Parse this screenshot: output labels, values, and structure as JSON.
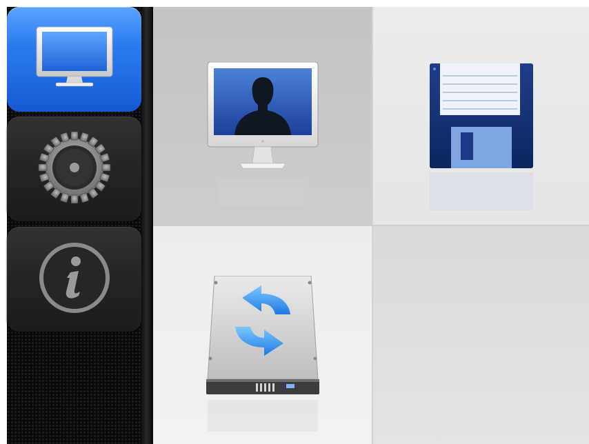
{
  "sidebar": {
    "items": [
      {
        "id": "display",
        "icon": "monitor-icon",
        "active": true
      },
      {
        "id": "settings",
        "icon": "gear-icon",
        "active": false
      },
      {
        "id": "info",
        "icon": "info-icon",
        "active": false
      }
    ]
  },
  "grid": {
    "tiles": [
      {
        "id": "display",
        "icon": "monitor-user-icon"
      },
      {
        "id": "save",
        "icon": "floppy-disk-icon"
      },
      {
        "id": "sync",
        "icon": "drive-sync-icon"
      },
      {
        "id": "empty",
        "icon": ""
      }
    ]
  },
  "colors": {
    "accent": "#2b7df0",
    "sidebar_bg": "#0a0a0a",
    "tile_bg": "#e6e6e6",
    "selected_tile_bg": "#c9c9c9"
  }
}
